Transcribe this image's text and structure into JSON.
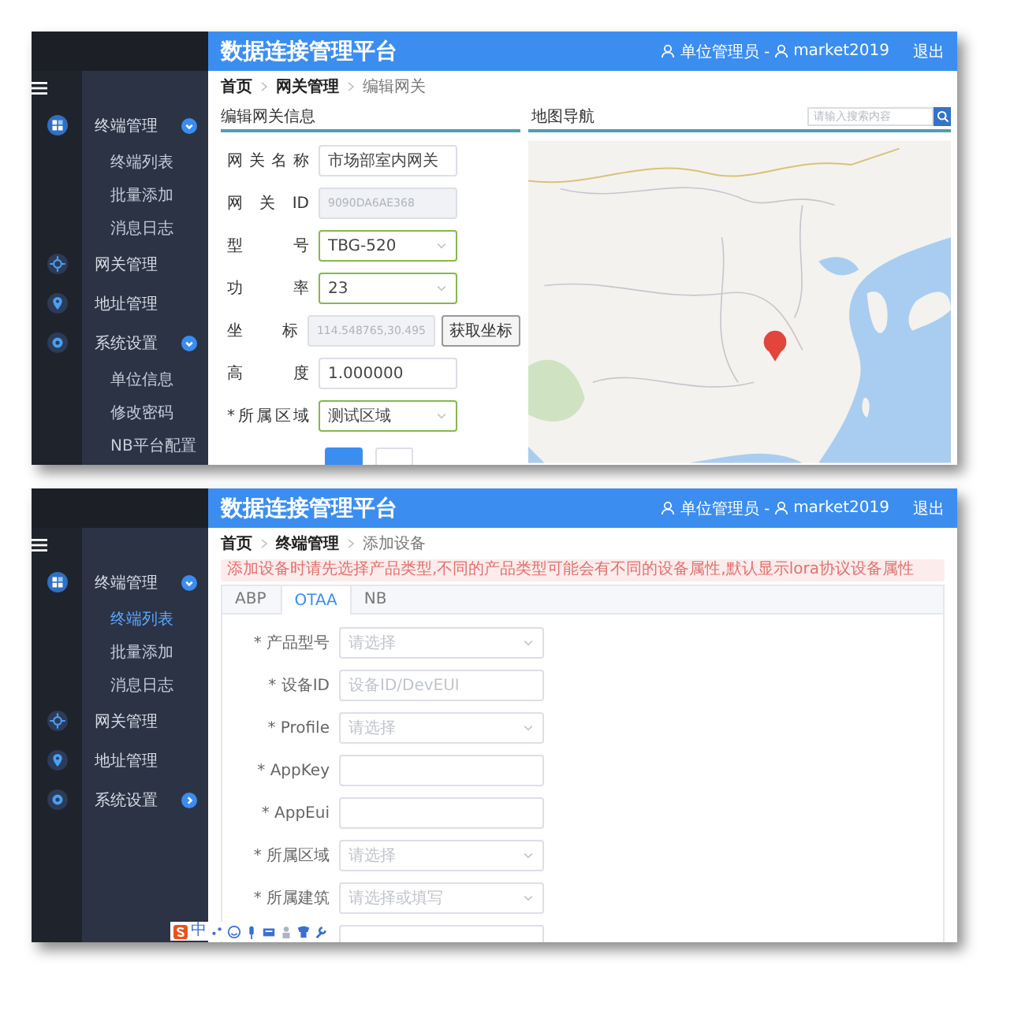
{
  "panels": [
    {
      "kind": "gateway_edit",
      "header": {
        "title": "数据连接管理平台",
        "role": "单位管理员 - ",
        "user": "market2019",
        "logout": "退出"
      },
      "sidebar": {
        "items": [
          {
            "label": "终端管理",
            "expanded": true,
            "children": [
              {
                "label": "终端列表",
                "selected": false
              },
              {
                "label": "批量添加",
                "selected": false
              },
              {
                "label": "消息日志",
                "selected": false
              }
            ]
          },
          {
            "label": "网关管理"
          },
          {
            "label": "地址管理"
          },
          {
            "label": "系统设置",
            "expanded": true,
            "children": [
              {
                "label": "单位信息",
                "selected": false
              },
              {
                "label": "修改密码",
                "selected": false
              },
              {
                "label": "NB平台配置",
                "selected": false
              }
            ]
          }
        ]
      },
      "breadcrumb": [
        "首页",
        "网关管理",
        "编辑网关"
      ],
      "form_title": "编辑网关信息",
      "fields": [
        {
          "label": "网 关 名 称",
          "kind": "text",
          "value": "市场部室内网关",
          "valid": false
        },
        {
          "label": "网 关 ID",
          "kind": "disabled",
          "value": "9090DA6AE368",
          "valid": false
        },
        {
          "label": "型 号",
          "kind": "select",
          "value": "TBG-520",
          "valid": true
        },
        {
          "label": "功 率",
          "kind": "select",
          "value": "23",
          "valid": true
        },
        {
          "label": "坐 标",
          "kind": "disabled",
          "value": "114.548765,30.495",
          "valid": false,
          "button": "获取坐标"
        },
        {
          "label": "高 度",
          "kind": "text",
          "value": "1.000000",
          "valid": false
        },
        {
          "label": "*所属区域",
          "kind": "select",
          "value": "测试区域",
          "valid": true
        }
      ],
      "actions": [
        {
          "kind": "primary"
        },
        {
          "kind": "default"
        }
      ],
      "map": {
        "title": "地图导航",
        "search": {
          "placeholder": "请输入搜索内容"
        },
        "kind": "picture"
      }
    },
    {
      "kind": "device_add",
      "header": {
        "title": "数据连接管理平台",
        "role": "单位管理员 - ",
        "user": "market2019",
        "logout": "退出"
      },
      "sidebar": {
        "items": [
          {
            "label": "终端管理",
            "expanded": true,
            "children": [
              {
                "label": "终端列表",
                "selected": true
              },
              {
                "label": "批量添加",
                "selected": false
              },
              {
                "label": "消息日志",
                "selected": false
              }
            ]
          },
          {
            "label": "网关管理"
          },
          {
            "label": "地址管理"
          },
          {
            "label": "系统设置",
            "expanded": false
          }
        ]
      },
      "breadcrumb": [
        "首页",
        "终端管理",
        "添加设备"
      ],
      "alert": "添加设备时请先选择产品类型,不同的产品类型可能会有不同的设备属性,默认显示lora协议设备属性",
      "tabs": [
        {
          "label": "ABP",
          "selected": false
        },
        {
          "label": "OTAA",
          "selected": true
        },
        {
          "label": "NB",
          "selected": false
        }
      ],
      "fields": [
        {
          "label": "* 产品型号",
          "kind": "select",
          "placeholder": "请选择"
        },
        {
          "label": "* 设备ID",
          "kind": "text",
          "placeholder": "设备ID/DevEUI"
        },
        {
          "label": "* Profile",
          "kind": "select",
          "placeholder": "请选择"
        },
        {
          "label": "* AppKey",
          "kind": "text"
        },
        {
          "label": "* AppEui",
          "kind": "text"
        },
        {
          "label": "* 所属区域",
          "kind": "select",
          "placeholder": "请选择"
        },
        {
          "label": "* 所属建筑",
          "kind": "select",
          "placeholder": "请选择或填写"
        },
        {
          "kind": "text"
        }
      ],
      "ime_toolbar": {
        "mode": "中"
      }
    }
  ]
}
